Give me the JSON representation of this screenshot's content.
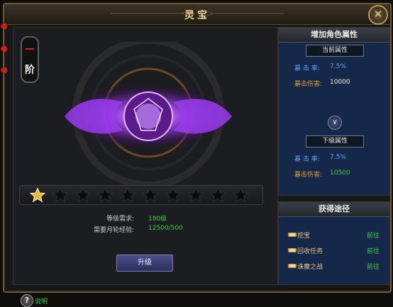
{
  "window": {
    "title": "灵宝",
    "close_symbol": "✕"
  },
  "rank": {
    "level_char": "一",
    "unit_char": "阶"
  },
  "stars": {
    "total": 10,
    "filled": 1
  },
  "requirements": [
    {
      "label": "等级需求:",
      "value": "180级"
    },
    {
      "label": "需要月轮经验:",
      "value": "12500/500"
    }
  ],
  "upgrade_button": {
    "label": "升级"
  },
  "help": {
    "icon": "question-icon",
    "symbol": "?",
    "label": "说明"
  },
  "attributes": {
    "header": "增加角色属性",
    "current": {
      "title": "当前属性",
      "rows": [
        {
          "label": "暴 击 率:",
          "value": "7.5%"
        },
        {
          "label": "暴击伤害:",
          "value": "10000"
        }
      ]
    },
    "next": {
      "title": "下级属性",
      "rows": [
        {
          "label": "暴 击 率:",
          "value": "7.5%"
        },
        {
          "label": "暴击伤害:",
          "value": "10500"
        }
      ]
    },
    "arrow_symbol": "∨"
  },
  "sources": {
    "header": "获得途径",
    "items": [
      {
        "name": "挖宝",
        "action": "前往"
      },
      {
        "name": "回收任务",
        "action": "前往"
      },
      {
        "name": "诛魔之战",
        "action": "前往"
      }
    ]
  },
  "colors": {
    "accent_gold": "#e7cf8f",
    "value_green": "#3ec93e",
    "label_blue": "#5fa8ff",
    "label_orange": "#e39a3a",
    "star_gold": "#e8b63a",
    "glow_purple": "#b04cff"
  }
}
